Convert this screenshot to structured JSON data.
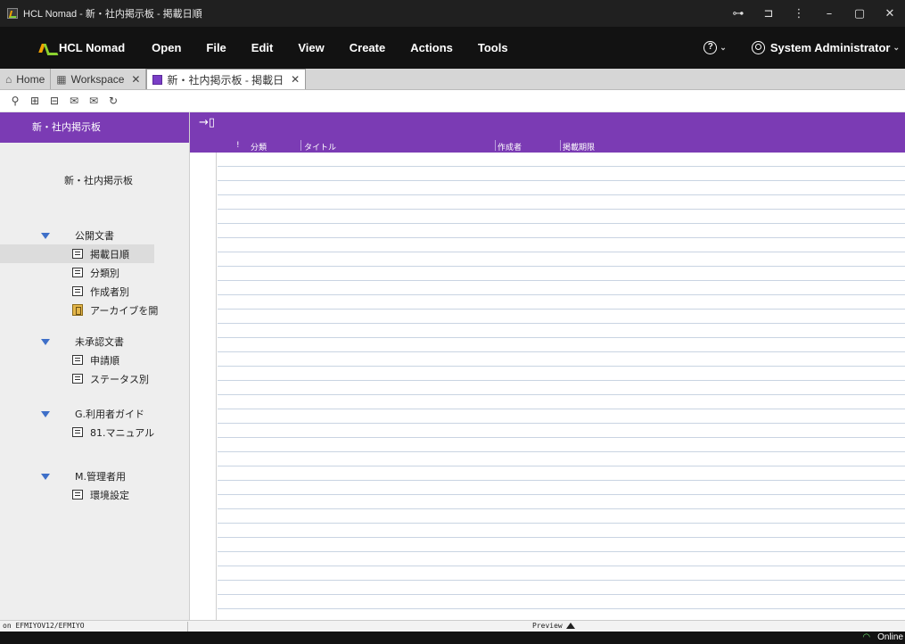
{
  "window": {
    "title": "HCL Nomad - 新・社内掲示板 - 掲載日順",
    "controls": [
      "⊶",
      "⊐",
      "⋮",
      "–",
      "▢",
      "✕"
    ]
  },
  "menubar": {
    "brand": "HCL Nomad",
    "items": [
      "Open",
      "File",
      "Edit",
      "View",
      "Create",
      "Actions",
      "Tools"
    ],
    "help_label": "?",
    "user_label": "System Administrator"
  },
  "tabs": [
    {
      "label": "Home",
      "icon": "home-icon"
    },
    {
      "label": "Workspace",
      "icon": "grid-icon"
    },
    {
      "label": "新・社内掲示板 - 掲載日",
      "icon": "database-icon",
      "active": true
    }
  ],
  "toolbar": {
    "buttons": [
      "search-icon",
      "expand-icon",
      "collapse-icon",
      "previous-unread-icon",
      "next-unread-icon",
      "refresh-icon"
    ]
  },
  "nav": {
    "header": "新・社内掲示板",
    "title": "新・社内掲示板",
    "sections": [
      {
        "label": "公開文書",
        "items": [
          {
            "label": "掲載日順",
            "icon": "view-icon",
            "selected": true
          },
          {
            "label": "分類別",
            "icon": "view-icon"
          },
          {
            "label": "作成者別",
            "icon": "view-icon"
          },
          {
            "label": "アーカイブを開",
            "icon": "archive-icon"
          }
        ]
      },
      {
        "label": "未承認文書",
        "items": [
          {
            "label": "申請順",
            "icon": "view-icon"
          },
          {
            "label": "ステータス別",
            "icon": "view-icon"
          }
        ]
      },
      {
        "label": "G.利用者ガイド",
        "items": [
          {
            "label": "81.マニュアル",
            "icon": "view-icon"
          }
        ]
      },
      {
        "label": "M.管理者用",
        "items": [
          {
            "label": "環境設定",
            "icon": "view-icon"
          }
        ]
      }
    ]
  },
  "view": {
    "columns": {
      "flag": "!",
      "category": "分類",
      "title": "タイトル",
      "author": "作成者",
      "expiry": "掲載期限"
    }
  },
  "status": {
    "server": "on EFMIYOV12/EFMIYO",
    "preview": "Preview"
  },
  "bottom": {
    "connection": "Online"
  },
  "colors": {
    "accent": "#7b3bb4",
    "titlebar": "#202020",
    "menubar": "#121212"
  }
}
